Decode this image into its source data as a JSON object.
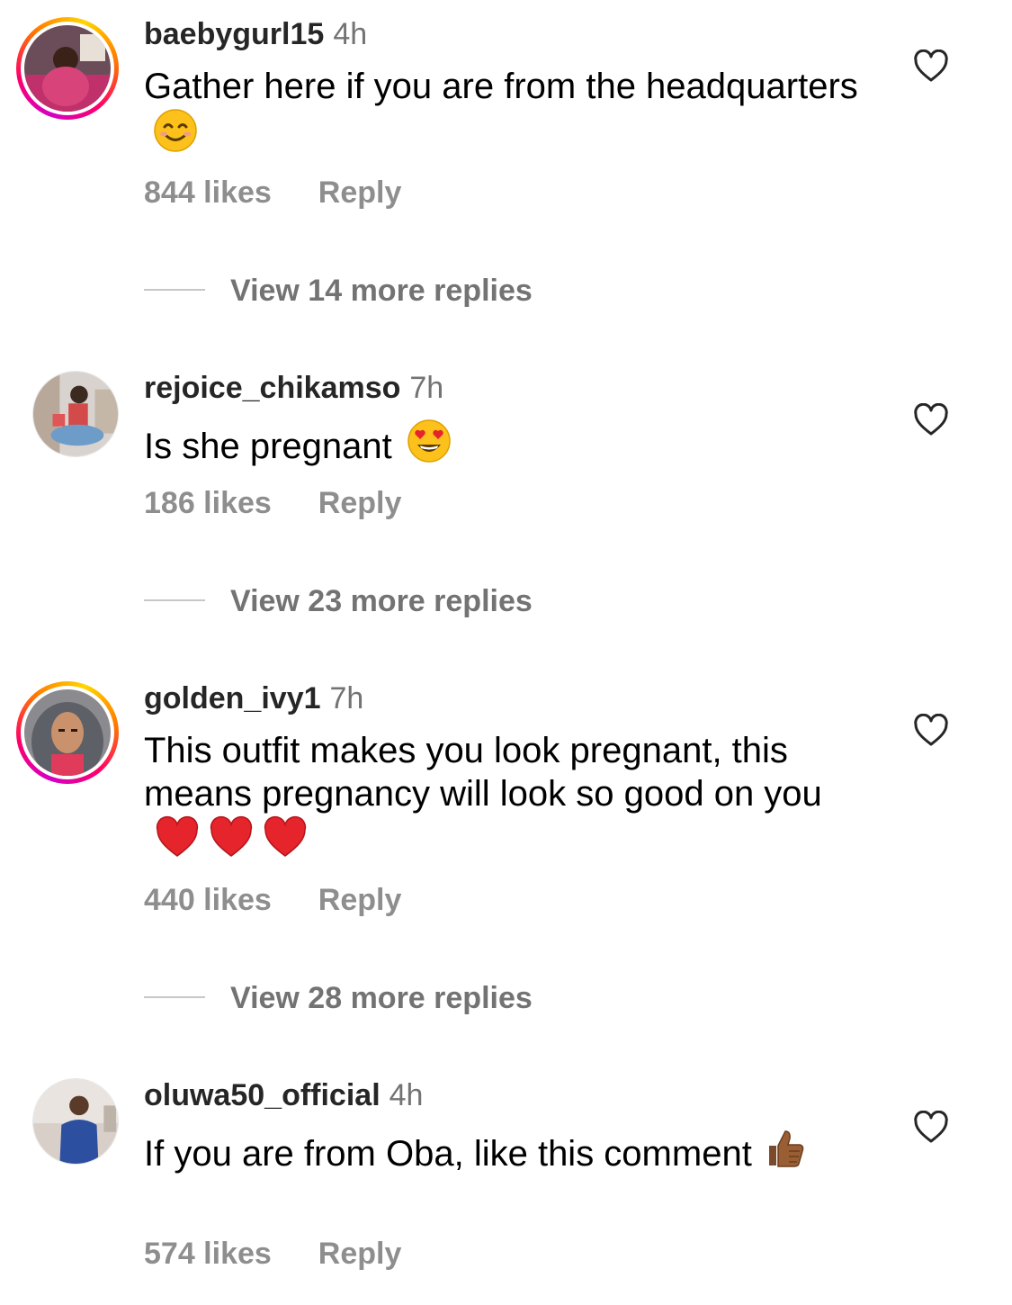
{
  "comments": [
    {
      "username": "baebygurl15",
      "time": "4h",
      "text": "Gather here if you are from the headquarters",
      "emoji": "smiling-face-icon",
      "likes": "844 likes",
      "reply": "Reply",
      "more_replies": "View 14 more replies",
      "has_story": true
    },
    {
      "username": "rejoice_chikamso",
      "time": "7h",
      "text": "Is she pregnant",
      "emoji": "heart-eyes-face-icon",
      "likes": "186 likes",
      "reply": "Reply",
      "more_replies": "View 23 more replies",
      "has_story": false
    },
    {
      "username": "golden_ivy1",
      "time": "7h",
      "text": "This outfit makes you look pregnant, this means pregnancy will look so good on you",
      "emoji": "red-heart-icon",
      "likes": "440 likes",
      "reply": "Reply",
      "more_replies": "View 28 more replies",
      "has_story": true
    },
    {
      "username": "oluwa50_official",
      "time": "4h",
      "text": "If you are from Oba, like this comment",
      "emoji": "thumbs-up-icon",
      "likes": "574 likes",
      "reply": "Reply",
      "has_story": false
    }
  ],
  "colors": {
    "username": "#262626",
    "secondary": "#8e8e8e",
    "divider": "#c7c7c7"
  }
}
